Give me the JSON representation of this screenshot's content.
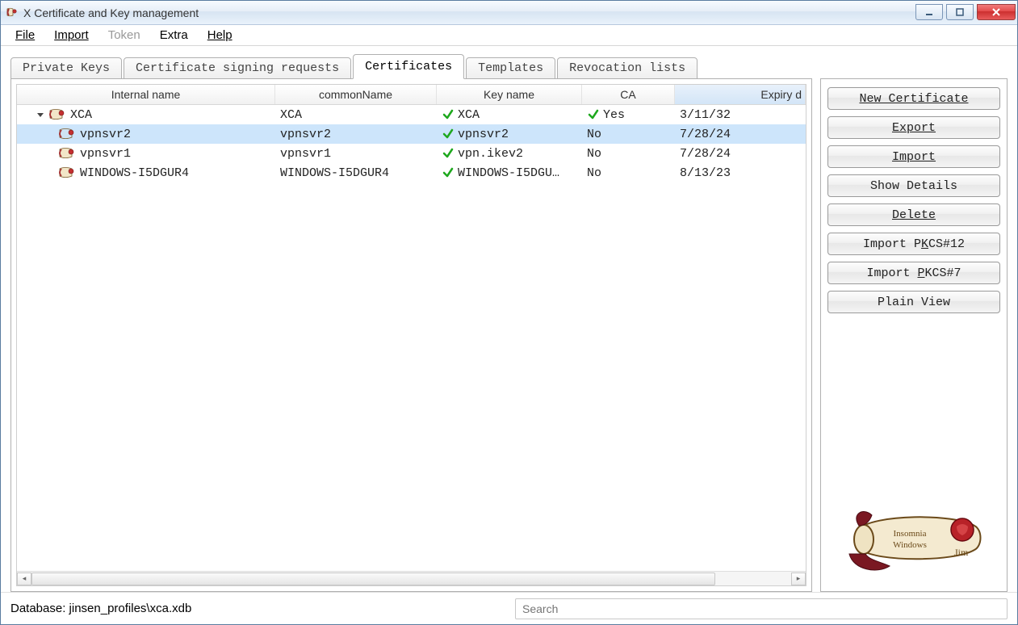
{
  "window": {
    "title": "X Certificate and Key management"
  },
  "menu": {
    "file": "File",
    "import": "Import",
    "token": "Token",
    "extra": "Extra",
    "help": "Help"
  },
  "tabs": {
    "private_keys": "Private Keys",
    "csr": "Certificate signing requests",
    "certificates": "Certificates",
    "templates": "Templates",
    "revocation": "Revocation lists"
  },
  "columns": {
    "internal_name": "Internal name",
    "common_name": "commonName",
    "key_name": "Key name",
    "ca": "CA",
    "expiry": "Expiry d"
  },
  "rows": [
    {
      "level": 0,
      "expanded": true,
      "iconStyle": "red",
      "name": "XCA",
      "common": "XCA",
      "key": "XCA",
      "key_check": true,
      "ca": "Yes",
      "ca_check": true,
      "expiry": "3/11/32",
      "selected": false
    },
    {
      "level": 1,
      "iconStyle": "blue",
      "name": "vpnsvr2",
      "common": "vpnsvr2",
      "key": "vpnsvr2",
      "key_check": true,
      "ca": "No",
      "ca_check": false,
      "expiry": "7/28/24",
      "selected": true
    },
    {
      "level": 1,
      "iconStyle": "red",
      "name": "vpnsvr1",
      "common": "vpnsvr1",
      "key": "vpn.ikev2",
      "key_check": true,
      "ca": "No",
      "ca_check": false,
      "expiry": "7/28/24",
      "selected": false
    },
    {
      "level": 1,
      "iconStyle": "red",
      "name": "WINDOWS-I5DGUR4",
      "common": "WINDOWS-I5DGUR4",
      "key": "WINDOWS-I5DGU…",
      "key_check": true,
      "ca": "No",
      "ca_check": false,
      "expiry": "8/13/23",
      "selected": false
    }
  ],
  "buttons": {
    "new_cert": "New Certificate",
    "export": "Export",
    "import": "Import",
    "show_details": "Show Details",
    "delete": "Delete",
    "import_pkcs12": "Import PKCS#12",
    "import_pkcs7": "Import PKCS#7",
    "plain_view": "Plain View"
  },
  "status": {
    "database_label": "Database: jinsen_profiles\\xca.xdb",
    "search_placeholder": "Search"
  }
}
